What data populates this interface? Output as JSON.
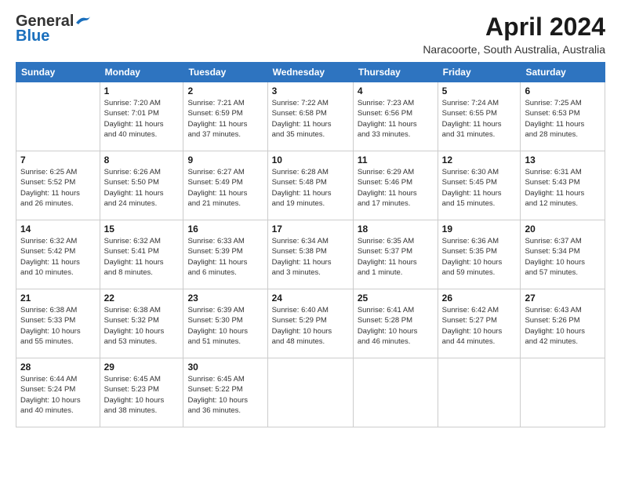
{
  "logo": {
    "line1": "General",
    "line2": "Blue"
  },
  "title": "April 2024",
  "location": "Naracoorte, South Australia, Australia",
  "days_of_week": [
    "Sunday",
    "Monday",
    "Tuesday",
    "Wednesday",
    "Thursday",
    "Friday",
    "Saturday"
  ],
  "weeks": [
    [
      {
        "day": "",
        "info": ""
      },
      {
        "day": "1",
        "info": "Sunrise: 7:20 AM\nSunset: 7:01 PM\nDaylight: 11 hours\nand 40 minutes."
      },
      {
        "day": "2",
        "info": "Sunrise: 7:21 AM\nSunset: 6:59 PM\nDaylight: 11 hours\nand 37 minutes."
      },
      {
        "day": "3",
        "info": "Sunrise: 7:22 AM\nSunset: 6:58 PM\nDaylight: 11 hours\nand 35 minutes."
      },
      {
        "day": "4",
        "info": "Sunrise: 7:23 AM\nSunset: 6:56 PM\nDaylight: 11 hours\nand 33 minutes."
      },
      {
        "day": "5",
        "info": "Sunrise: 7:24 AM\nSunset: 6:55 PM\nDaylight: 11 hours\nand 31 minutes."
      },
      {
        "day": "6",
        "info": "Sunrise: 7:25 AM\nSunset: 6:53 PM\nDaylight: 11 hours\nand 28 minutes."
      }
    ],
    [
      {
        "day": "7",
        "info": "Sunrise: 6:25 AM\nSunset: 5:52 PM\nDaylight: 11 hours\nand 26 minutes."
      },
      {
        "day": "8",
        "info": "Sunrise: 6:26 AM\nSunset: 5:50 PM\nDaylight: 11 hours\nand 24 minutes."
      },
      {
        "day": "9",
        "info": "Sunrise: 6:27 AM\nSunset: 5:49 PM\nDaylight: 11 hours\nand 21 minutes."
      },
      {
        "day": "10",
        "info": "Sunrise: 6:28 AM\nSunset: 5:48 PM\nDaylight: 11 hours\nand 19 minutes."
      },
      {
        "day": "11",
        "info": "Sunrise: 6:29 AM\nSunset: 5:46 PM\nDaylight: 11 hours\nand 17 minutes."
      },
      {
        "day": "12",
        "info": "Sunrise: 6:30 AM\nSunset: 5:45 PM\nDaylight: 11 hours\nand 15 minutes."
      },
      {
        "day": "13",
        "info": "Sunrise: 6:31 AM\nSunset: 5:43 PM\nDaylight: 11 hours\nand 12 minutes."
      }
    ],
    [
      {
        "day": "14",
        "info": "Sunrise: 6:32 AM\nSunset: 5:42 PM\nDaylight: 11 hours\nand 10 minutes."
      },
      {
        "day": "15",
        "info": "Sunrise: 6:32 AM\nSunset: 5:41 PM\nDaylight: 11 hours\nand 8 minutes."
      },
      {
        "day": "16",
        "info": "Sunrise: 6:33 AM\nSunset: 5:39 PM\nDaylight: 11 hours\nand 6 minutes."
      },
      {
        "day": "17",
        "info": "Sunrise: 6:34 AM\nSunset: 5:38 PM\nDaylight: 11 hours\nand 3 minutes."
      },
      {
        "day": "18",
        "info": "Sunrise: 6:35 AM\nSunset: 5:37 PM\nDaylight: 11 hours\nand 1 minute."
      },
      {
        "day": "19",
        "info": "Sunrise: 6:36 AM\nSunset: 5:35 PM\nDaylight: 10 hours\nand 59 minutes."
      },
      {
        "day": "20",
        "info": "Sunrise: 6:37 AM\nSunset: 5:34 PM\nDaylight: 10 hours\nand 57 minutes."
      }
    ],
    [
      {
        "day": "21",
        "info": "Sunrise: 6:38 AM\nSunset: 5:33 PM\nDaylight: 10 hours\nand 55 minutes."
      },
      {
        "day": "22",
        "info": "Sunrise: 6:38 AM\nSunset: 5:32 PM\nDaylight: 10 hours\nand 53 minutes."
      },
      {
        "day": "23",
        "info": "Sunrise: 6:39 AM\nSunset: 5:30 PM\nDaylight: 10 hours\nand 51 minutes."
      },
      {
        "day": "24",
        "info": "Sunrise: 6:40 AM\nSunset: 5:29 PM\nDaylight: 10 hours\nand 48 minutes."
      },
      {
        "day": "25",
        "info": "Sunrise: 6:41 AM\nSunset: 5:28 PM\nDaylight: 10 hours\nand 46 minutes."
      },
      {
        "day": "26",
        "info": "Sunrise: 6:42 AM\nSunset: 5:27 PM\nDaylight: 10 hours\nand 44 minutes."
      },
      {
        "day": "27",
        "info": "Sunrise: 6:43 AM\nSunset: 5:26 PM\nDaylight: 10 hours\nand 42 minutes."
      }
    ],
    [
      {
        "day": "28",
        "info": "Sunrise: 6:44 AM\nSunset: 5:24 PM\nDaylight: 10 hours\nand 40 minutes."
      },
      {
        "day": "29",
        "info": "Sunrise: 6:45 AM\nSunset: 5:23 PM\nDaylight: 10 hours\nand 38 minutes."
      },
      {
        "day": "30",
        "info": "Sunrise: 6:45 AM\nSunset: 5:22 PM\nDaylight: 10 hours\nand 36 minutes."
      },
      {
        "day": "",
        "info": ""
      },
      {
        "day": "",
        "info": ""
      },
      {
        "day": "",
        "info": ""
      },
      {
        "day": "",
        "info": ""
      }
    ]
  ]
}
